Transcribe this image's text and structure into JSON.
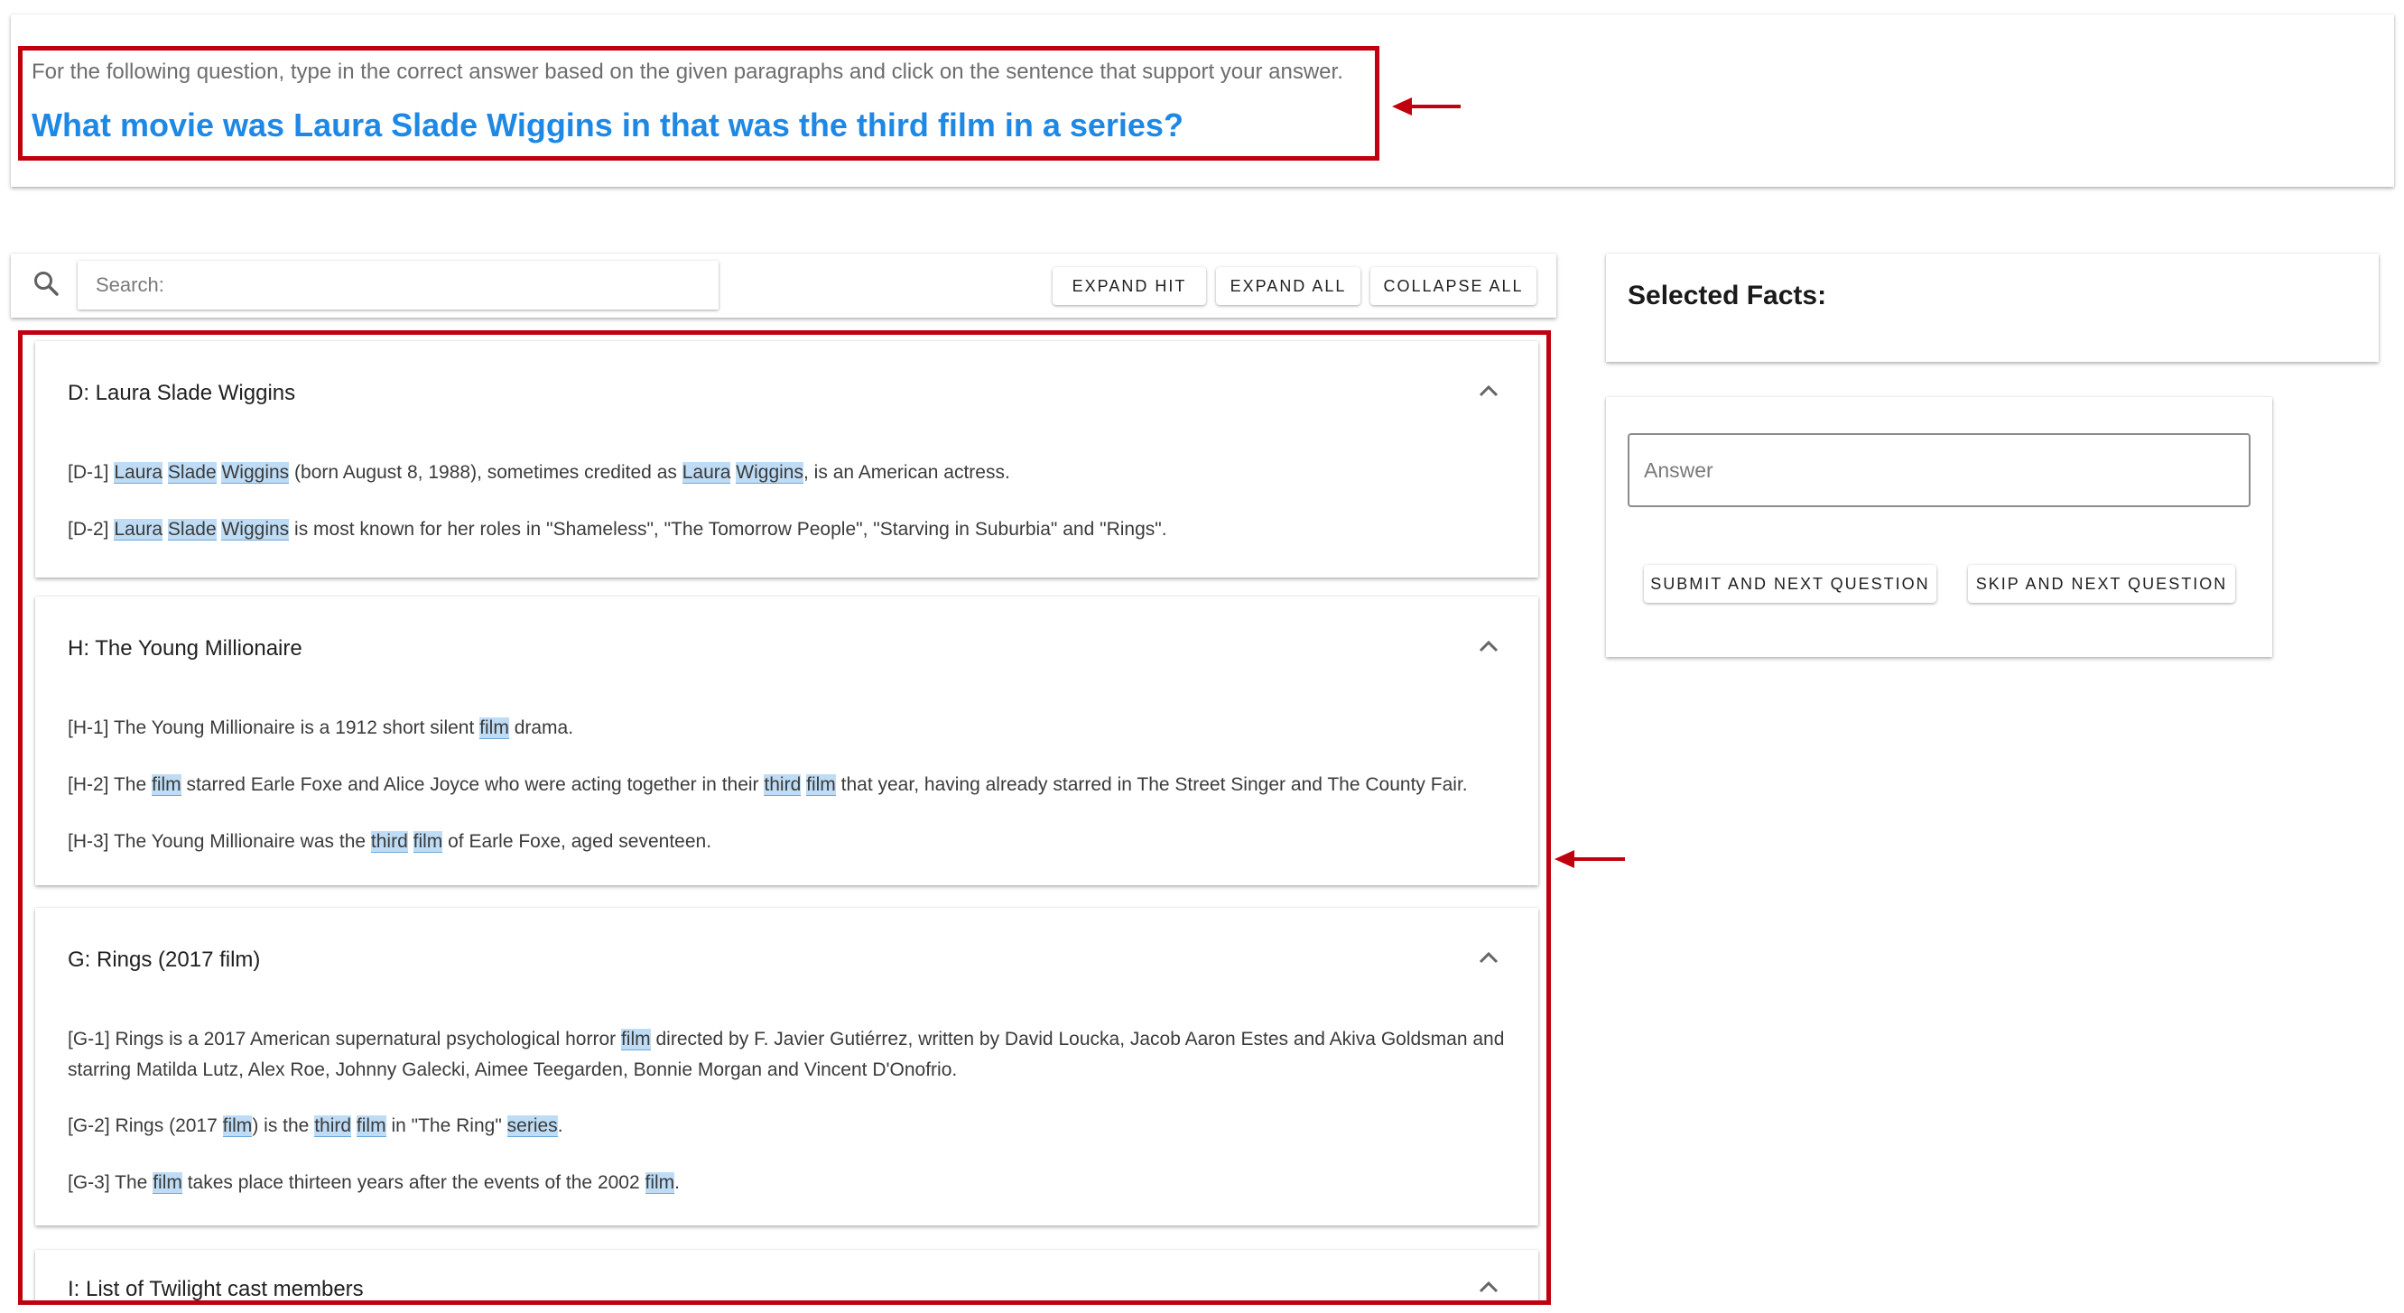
{
  "question_section": {
    "instruction": "For the following question, type in the correct answer based on the given paragraphs and click on the sentence that support your answer.",
    "question": "What movie was Laura Slade Wiggins in that was the third film in a series?"
  },
  "toolbar": {
    "search_placeholder": "Search:",
    "expand_hit_label": "EXPAND HIT",
    "expand_all_label": "EXPAND ALL",
    "collapse_all_label": "COLLAPSE ALL"
  },
  "paragraphs": [
    {
      "title": "D: Laura Slade Wiggins",
      "sentences": [
        {
          "text": "[D-1] Laura Slade Wiggins (born August 8, 1988), sometimes credited as Laura Wiggins, is an American actress.",
          "highlights": [
            "Laura",
            "Slade",
            "Wiggins"
          ]
        },
        {
          "text": "[D-2] Laura Slade Wiggins is most known for her roles in \"Shameless\", \"The Tomorrow People\", \"Starving in Suburbia\" and \"Rings\".",
          "highlights": [
            "Laura",
            "Slade",
            "Wiggins"
          ]
        }
      ]
    },
    {
      "title": "H: The Young Millionaire",
      "sentences": [
        {
          "text": "[H-1] The Young Millionaire is a 1912 short silent film drama.",
          "highlights": [
            "film"
          ]
        },
        {
          "text": "[H-2] The film starred Earle Foxe and Alice Joyce who were acting together in their third film that year, having already starred in The Street Singer and The County Fair.",
          "highlights": [
            "film",
            "third"
          ]
        },
        {
          "text": "[H-3] The Young Millionaire was the third film of Earle Foxe, aged seventeen.",
          "highlights": [
            "third",
            "film"
          ]
        }
      ]
    },
    {
      "title": "G: Rings (2017 film)",
      "sentences": [
        {
          "text": "[G-1] Rings is a 2017 American supernatural psychological horror film directed by F. Javier Gutiérrez, written by David Loucka, Jacob Aaron Estes and Akiva Goldsman and starring Matilda Lutz, Alex Roe, Johnny Galecki, Aimee Teegarden, Bonnie Morgan and Vincent D'Onofrio.",
          "highlights": [
            "film"
          ]
        },
        {
          "text": "[G-2] Rings (2017 film) is the third film in \"The Ring\" series.",
          "highlights": [
            "film",
            "third",
            "series"
          ]
        },
        {
          "text": "[G-3] The film takes place thirteen years after the events of the 2002 film.",
          "highlights": [
            "film"
          ]
        }
      ]
    },
    {
      "title": "I: List of Twilight cast members",
      "sentences": []
    }
  ],
  "facts_panel": {
    "title": "Selected Facts:"
  },
  "answer_panel": {
    "answer_placeholder": "Answer",
    "submit_label": "SUBMIT AND NEXT QUESTION",
    "skip_label": "SKIP AND NEXT QUESTION"
  },
  "colors": {
    "accent_blue": "#1e88e5",
    "annotation_red": "#c0000e",
    "highlight": "#bedcf5"
  },
  "icons": [
    "search-icon",
    "chevron-up-icon",
    "arrow-left-icon"
  ]
}
